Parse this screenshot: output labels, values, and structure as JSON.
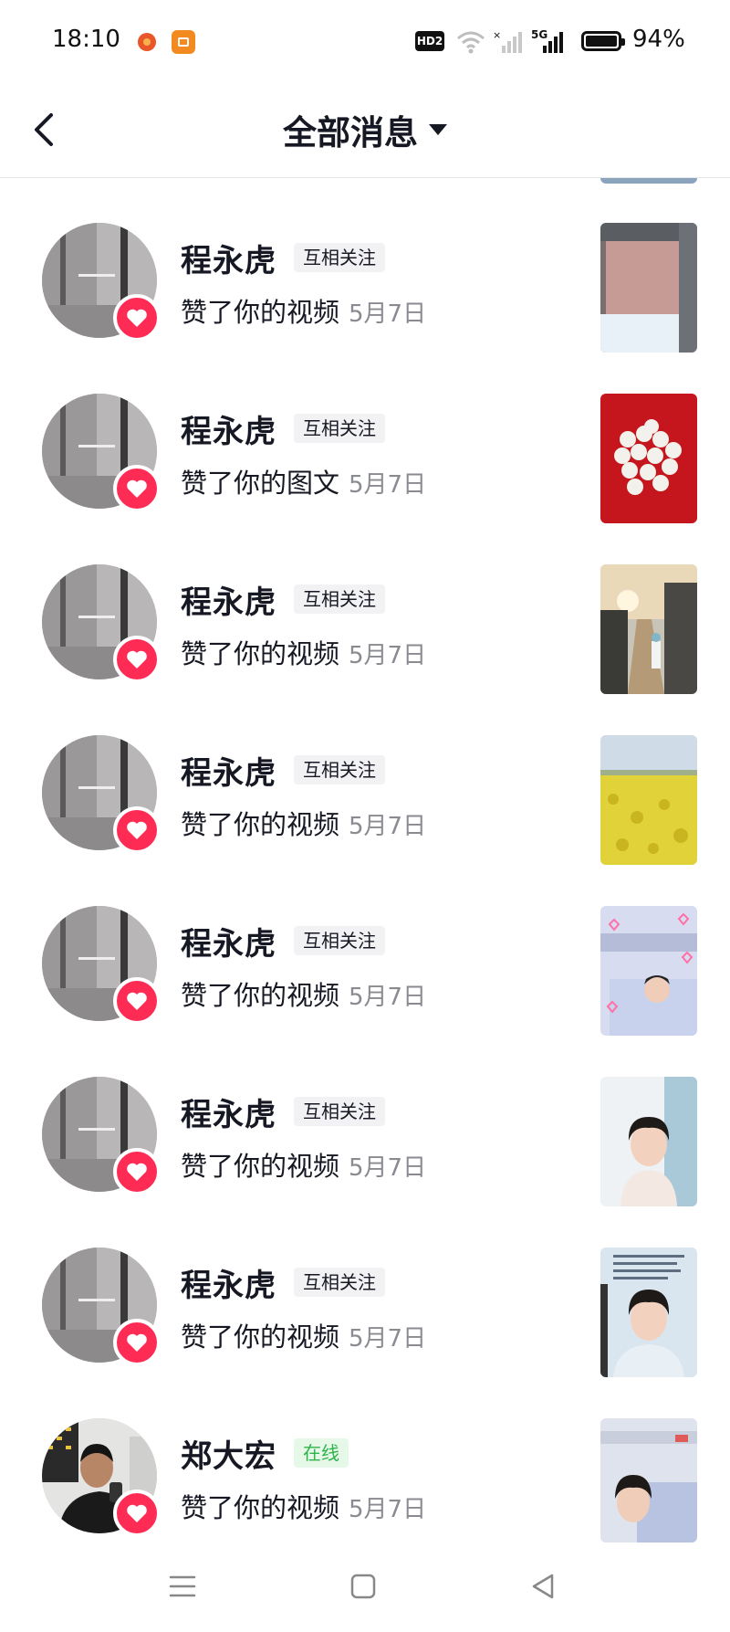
{
  "status_bar": {
    "time": "18:10",
    "hd_badge": "HD2",
    "battery_percent": "94%",
    "icons": [
      "app-notification-icon",
      "app-notification-icon",
      "wifi-icon",
      "signal-icon",
      "5g-signal-icon",
      "battery-icon"
    ]
  },
  "header": {
    "title": "全部消息",
    "back_icon": "chevron-left-icon",
    "dropdown_icon": "caret-down-icon"
  },
  "messages": [
    {
      "name": "程永虎",
      "tag": "互相关注",
      "action": "赞了你的视频",
      "date": "5月7日",
      "thumb": "window-frame"
    },
    {
      "name": "程永虎",
      "tag": "互相关注",
      "action": "赞了你的图文",
      "date": "5月7日",
      "thumb": "white-balls-red"
    },
    {
      "name": "程永虎",
      "tag": "互相关注",
      "action": "赞了你的视频",
      "date": "5月7日",
      "thumb": "alley-sunset"
    },
    {
      "name": "程永虎",
      "tag": "互相关注",
      "action": "赞了你的视频",
      "date": "5月7日",
      "thumb": "flower-field"
    },
    {
      "name": "程永虎",
      "tag": "互相关注",
      "action": "赞了你的视频",
      "date": "5月7日",
      "thumb": "hospital-hearts"
    },
    {
      "name": "程永虎",
      "tag": "互相关注",
      "action": "赞了你的视频",
      "date": "5月7日",
      "thumb": "woman-portrait"
    },
    {
      "name": "程永虎",
      "tag": "互相关注",
      "action": "赞了你的视频",
      "date": "5月7日",
      "thumb": "woman-text"
    },
    {
      "name": "郑大宏",
      "tag": "在线",
      "action": "赞了你的视频",
      "date": "5月7日",
      "thumb": "hospital-bed"
    }
  ],
  "colors": {
    "like_badge": "#fe2c55",
    "online_tag_text": "#2fb34a",
    "date_text": "#8a8b91"
  },
  "nav": {
    "icons": [
      "menu-icon",
      "home-square-icon",
      "back-triangle-icon"
    ]
  }
}
